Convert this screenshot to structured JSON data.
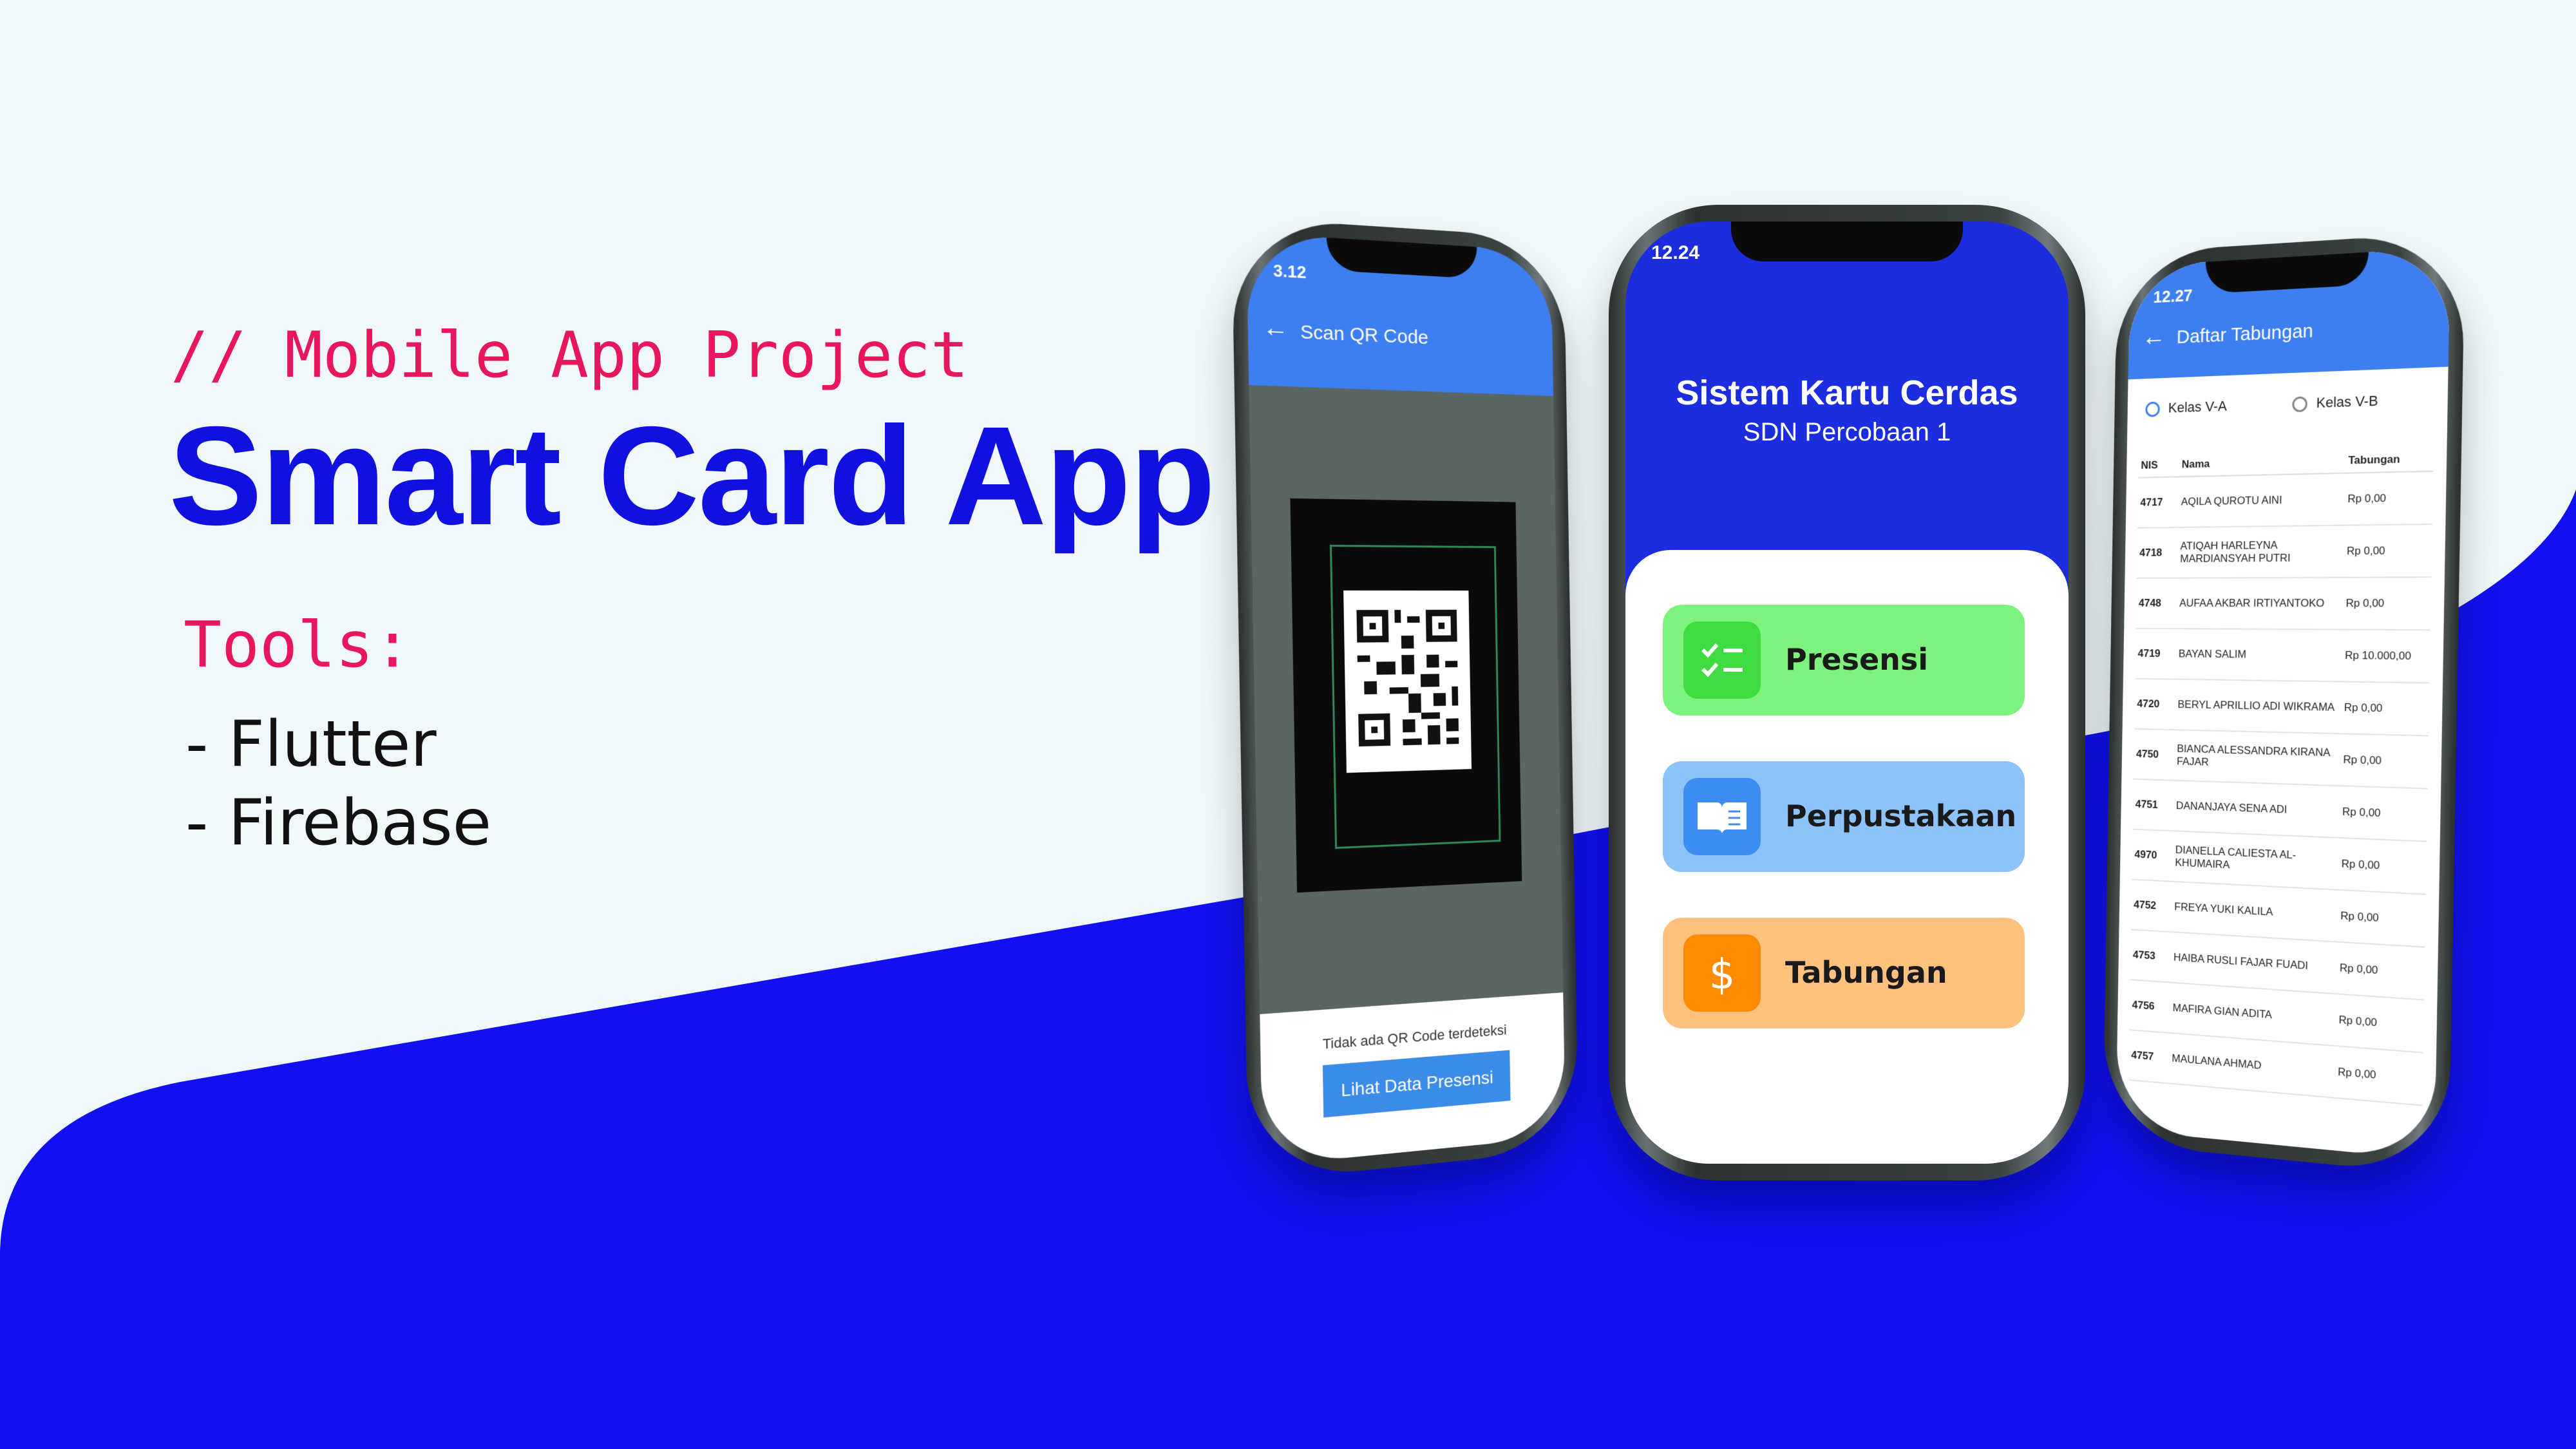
{
  "header": {
    "tagline": "// Mobile App Project",
    "title": "Smart Card App"
  },
  "tools": {
    "heading": "Tools:",
    "items": [
      "- Flutter",
      "- Firebase"
    ]
  },
  "colors": {
    "accent_pink": "#e8175d",
    "brand_blue": "#1010e0",
    "app_blue": "#1c2de0",
    "presensi": "#7df37d",
    "perpustakaan": "#8ec2fb",
    "tabungan": "#ffc27e"
  },
  "phone_left": {
    "status_time": "3.12",
    "title": "Scan QR Code",
    "message": "Tidak ada QR Code terdeteksi",
    "button": "Lihat Data Presensi"
  },
  "phone_center": {
    "status_time": "12.24",
    "app_title": "Sistem Kartu Cerdas",
    "app_subtitle": "SDN Percobaan 1",
    "menu": [
      {
        "label": "Presensi",
        "icon": "checklist-icon"
      },
      {
        "label": "Perpustakaan",
        "icon": "book-icon"
      },
      {
        "label": "Tabungan",
        "icon": "dollar-icon"
      }
    ]
  },
  "phone_right": {
    "status_time": "12.27",
    "title": "Daftar Tabungan",
    "radio_a": "Kelas V-A",
    "radio_b": "Kelas V-B",
    "columns": [
      "NIS",
      "Nama",
      "Tabungan"
    ],
    "rows": [
      {
        "nis": "4717",
        "nama": "AQILA QUROTU AINI",
        "tabungan": "Rp 0,00"
      },
      {
        "nis": "4718",
        "nama": "ATIQAH HARLEYNA MARDIANSYAH PUTRI",
        "tabungan": "Rp 0,00"
      },
      {
        "nis": "4748",
        "nama": "AUFAA AKBAR IRTIYANTOKO",
        "tabungan": "Rp 0,00"
      },
      {
        "nis": "4719",
        "nama": "BAYAN SALIM",
        "tabungan": "Rp 10.000,00"
      },
      {
        "nis": "4720",
        "nama": "BERYL APRILLIO ADI WIKRAMA",
        "tabungan": "Rp 0,00"
      },
      {
        "nis": "4750",
        "nama": "BIANCA ALESSANDRA KIRANA FAJAR",
        "tabungan": "Rp 0,00"
      },
      {
        "nis": "4751",
        "nama": "DANANJAYA SENA ADI",
        "tabungan": "Rp 0,00"
      },
      {
        "nis": "4970",
        "nama": "DIANELLA CALIESTA AL-KHUMAIRA",
        "tabungan": "Rp 0,00"
      },
      {
        "nis": "4752",
        "nama": "FREYA YUKI KALILA",
        "tabungan": "Rp 0,00"
      },
      {
        "nis": "4753",
        "nama": "HAIBA RUSLI FAJAR FUADI",
        "tabungan": "Rp 0,00"
      },
      {
        "nis": "4756",
        "nama": "MAFIRA GIAN ADITA",
        "tabungan": "Rp 0,00"
      },
      {
        "nis": "4757",
        "nama": "MAULANA AHMAD",
        "tabungan": "Rp 0,00"
      }
    ]
  }
}
